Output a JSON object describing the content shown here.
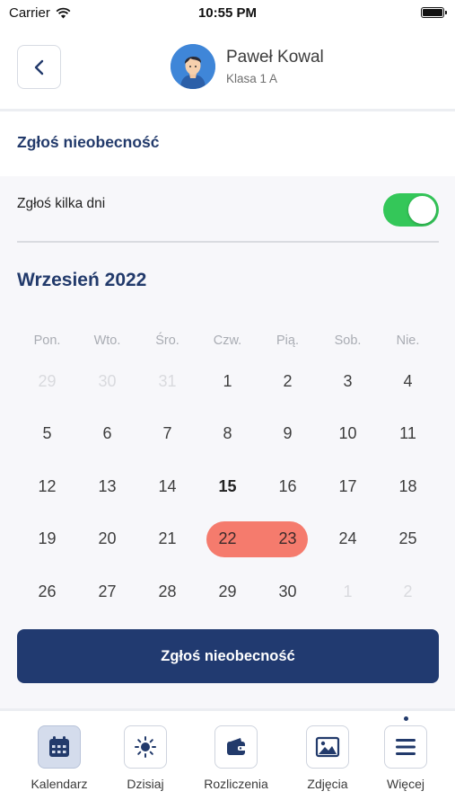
{
  "status_bar": {
    "carrier": "Carrier",
    "time": "10:55 PM"
  },
  "header": {
    "user_name": "Paweł Kowal",
    "user_class": "Klasa 1 A"
  },
  "section_title": "Zgłoś nieobecność",
  "multi_day": {
    "label": "Zgłoś kilka dni",
    "enabled": true
  },
  "calendar": {
    "month_title": "Wrzesień 2022",
    "weekdays": [
      "Pon.",
      "Wto.",
      "Śro.",
      "Czw.",
      "Pią.",
      "Sob.",
      "Nie."
    ],
    "weeks": [
      [
        "29",
        "30",
        "31",
        "1",
        "2",
        "3",
        "4"
      ],
      [
        "5",
        "6",
        "7",
        "8",
        "9",
        "10",
        "11"
      ],
      [
        "12",
        "13",
        "14",
        "15",
        "16",
        "17",
        "18"
      ],
      [
        "19",
        "20",
        "21",
        "22",
        "23",
        "24",
        "25"
      ],
      [
        "26",
        "27",
        "28",
        "29",
        "30",
        "1",
        "2"
      ]
    ],
    "today": "15",
    "selected_start": "22",
    "selected_end": "23",
    "accent_color": "#f57b6d"
  },
  "submit_button": {
    "label": "Zgłoś nieobecność"
  },
  "tabbar": {
    "items": [
      {
        "label": "Kalendarz",
        "icon": "calendar-icon"
      },
      {
        "label": "Dzisiaj",
        "icon": "sun-icon"
      },
      {
        "label": "Rozliczenia",
        "icon": "wallet-icon"
      },
      {
        "label": "Zdjęcia",
        "icon": "image-icon"
      },
      {
        "label": "Więcej",
        "icon": "menu-icon"
      }
    ]
  },
  "colors": {
    "primary": "#213a70",
    "toggle_on": "#34c759"
  }
}
